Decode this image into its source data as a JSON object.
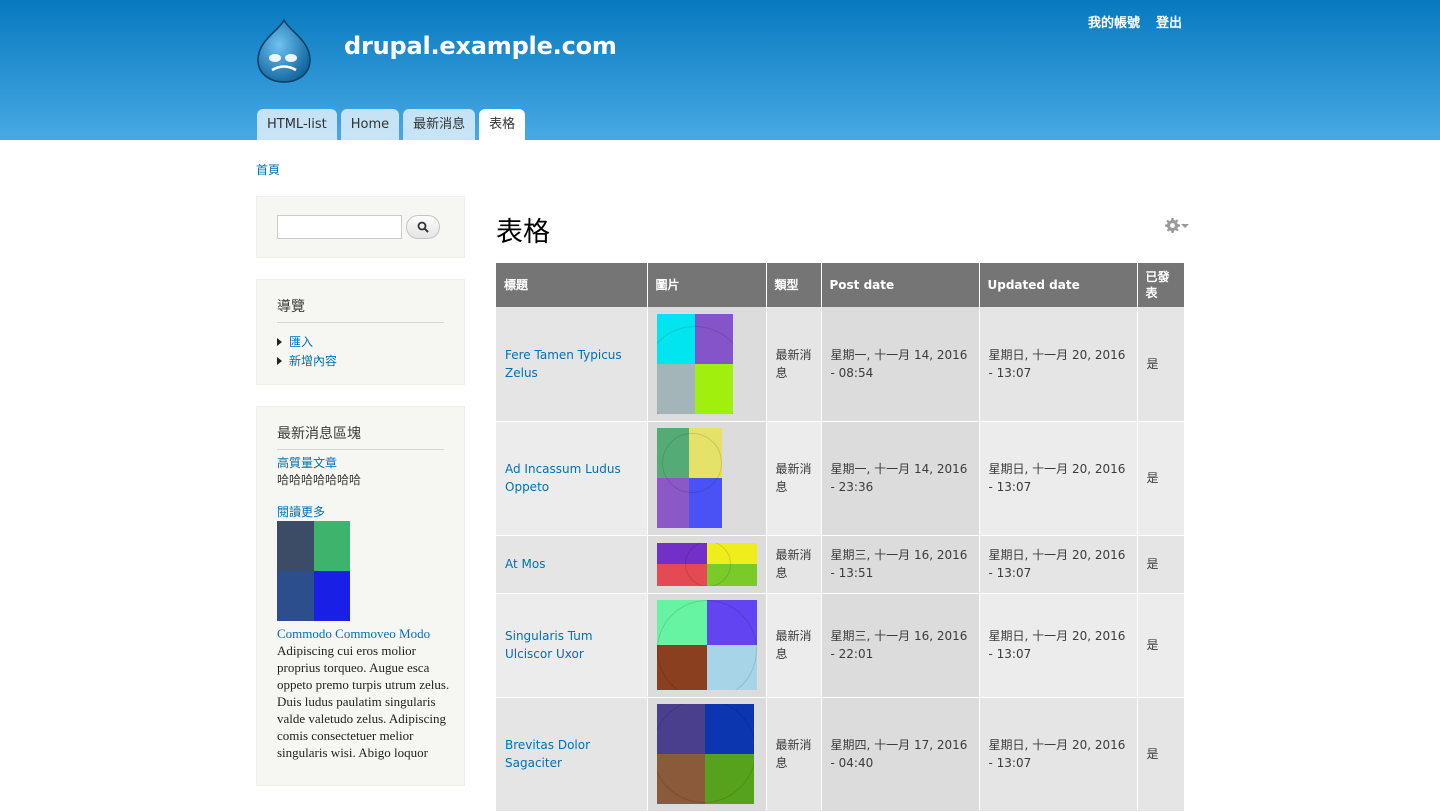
{
  "site": {
    "name": "drupal.example.com"
  },
  "secondary_menu": [
    "我的帳號",
    "登出"
  ],
  "main_menu": [
    {
      "label": "HTML-list",
      "active": false
    },
    {
      "label": "Home",
      "active": false
    },
    {
      "label": "最新消息",
      "active": false
    },
    {
      "label": "表格",
      "active": true
    }
  ],
  "breadcrumb": "首頁",
  "search": {
    "placeholder": "",
    "button_icon": "search-icon"
  },
  "nav_block": {
    "title": "導覽",
    "items": [
      "匯入",
      "新增內容"
    ]
  },
  "news_block": {
    "title": "最新消息區塊",
    "article_link": "高質量文章",
    "article_text": "哈哈哈哈哈哈哈",
    "read_more": "閱讀更多",
    "thumb_colors": [
      "#3c4b66",
      "#3db36b",
      "#2d4e8d",
      "#1a1fe6"
    ],
    "second_title": "Commodo Commoveo Modo",
    "second_text": "Adipiscing cui eros molior proprius torqueo. Augue esca oppeto premo turpis utrum zelus. Duis ludus paulatim singularis valde valetudo zelus. Adipiscing comis consectetuer melior singularis wisi. Abigo loquor"
  },
  "page_title": "表格",
  "table": {
    "headers": [
      "標題",
      "圖片",
      "類型",
      "Post date",
      "Updated date",
      "已發表"
    ],
    "rows": [
      {
        "title": "Fere Tamen Typicus Zelus",
        "colors": [
          "#00e5ef",
          "#8554c9",
          "#a3b5b8",
          "#a1ef0c"
        ],
        "type": "最新消息",
        "post_date": "星期一, 十一月 14, 2016 - 08:54",
        "updated_date": "星期日, 十一月 20, 2016 - 13:07",
        "published": "是"
      },
      {
        "title": "Ad Incassum Ludus Oppeto",
        "colors": [
          "#55ab76",
          "#e5e26a",
          "#8a58c7",
          "#4b52f5"
        ],
        "type": "最新消息",
        "post_date": "星期一, 十一月 14, 2016 - 23:36",
        "updated_date": "星期日, 十一月 20, 2016 - 13:07",
        "published": "是"
      },
      {
        "title": "At Mos",
        "colors": [
          "#7230c8",
          "#efee1c",
          "#e44a54",
          "#7acb2a"
        ],
        "type": "最新消息",
        "post_date": "星期三, 十一月 16, 2016 - 13:51",
        "updated_date": "星期日, 十一月 20, 2016 - 13:07",
        "published": "是"
      },
      {
        "title": "Singularis Tum Ulciscor Uxor",
        "colors": [
          "#66f4a3",
          "#6244f1",
          "#8a3f1f",
          "#a7d5e7"
        ],
        "type": "最新消息",
        "post_date": "星期三, 十一月 16, 2016 - 22:01",
        "updated_date": "星期日, 十一月 20, 2016 - 13:07",
        "published": "是"
      },
      {
        "title": "Brevitas Dolor Sagaciter",
        "colors": [
          "#4a3f8c",
          "#0b36b0",
          "#8a5a3a",
          "#57a21d"
        ],
        "type": "最新消息",
        "post_date": "星期四, 十一月 17, 2016 - 04:40",
        "updated_date": "星期日, 十一月 20, 2016 - 13:07",
        "published": "是"
      }
    ]
  },
  "colors": {
    "header_top": "#0779bf",
    "header_bottom": "#48a9e4",
    "link": "#0071b3",
    "table_header": "#757575"
  }
}
